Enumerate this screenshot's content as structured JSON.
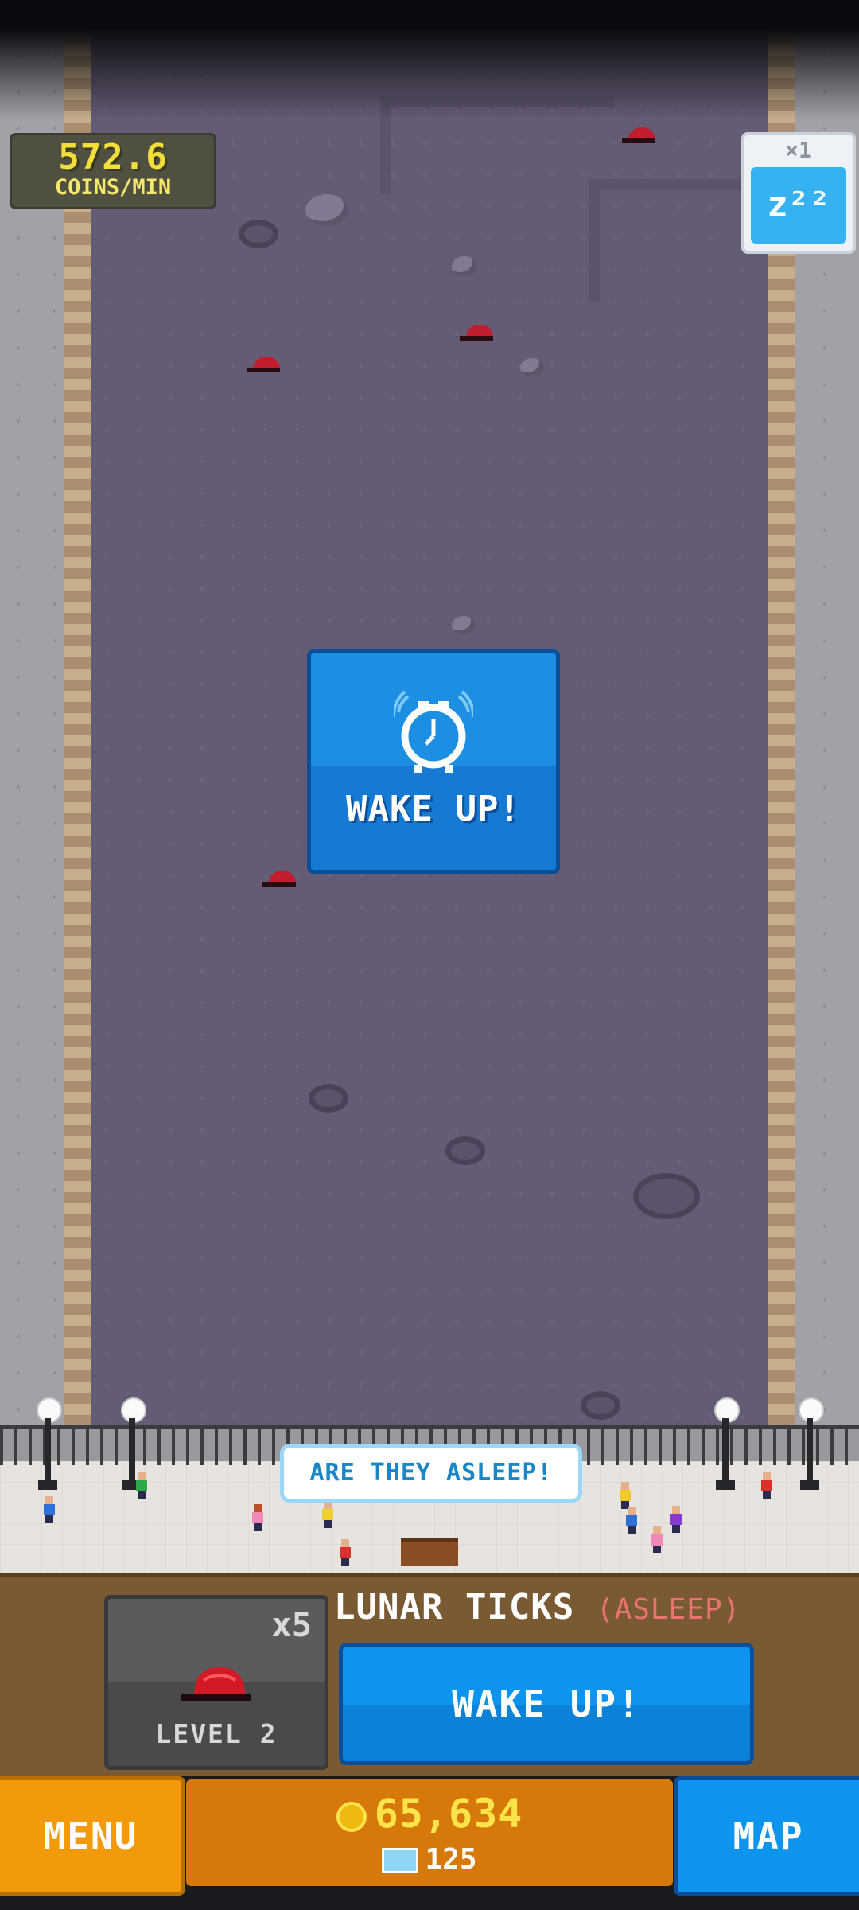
{
  "hud": {
    "coins_rate": "572.6",
    "coins_rate_unit": "COINS/MIN",
    "sleep_multiplier": "×1",
    "sleep_symbol": "z²²"
  },
  "wake_card": {
    "label": "WAKE UP!",
    "icon": "alarm-clock-icon"
  },
  "speech_bubble": "ARE THEY ASLEEP!",
  "creature": {
    "count": "x5",
    "level": "LEVEL 2",
    "name": "LUNAR TICKS",
    "state": "(ASLEEP)",
    "icon": "lunar-tick-icon"
  },
  "wake_button": {
    "label": "WAKE UP!"
  },
  "bottom_bar": {
    "menu_label": "MENU",
    "map_label": "MAP",
    "coins": "65,634",
    "gems": "125"
  },
  "colors": {
    "field": "#645b74",
    "button_blue": "#0d94ee",
    "menu_orange": "#f39a0b",
    "coin_yellow": "#ffe34a",
    "asleep_red": "#e9746f"
  }
}
